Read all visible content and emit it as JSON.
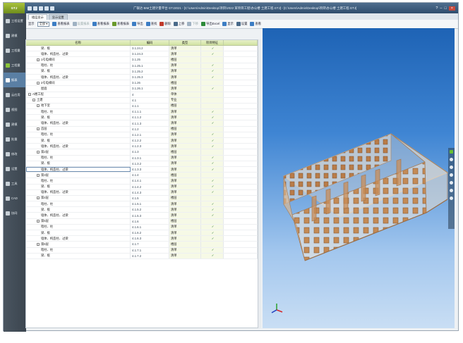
{
  "app": {
    "logo": "GTJ",
    "title": "广联达 BIM土建计量平台 GTJ2021 - [C:\\Users\\Admin\\Desktop\\项目\\2022 某项目工程\\办公楼 土建工程.GTJ] - [C:\\Users\\Admin\\Desktop\\项目\\办公楼 土建工程.GTJ]"
  },
  "sidebar": {
    "items": [
      {
        "label": "工程设置",
        "icon": "settings-icon"
      },
      {
        "label": "建模",
        "icon": "pencil-icon"
      },
      {
        "label": "工程量",
        "icon": "calculator-icon"
      },
      {
        "label": "工程量",
        "icon": "list-icon"
      },
      {
        "label": "报表",
        "icon": "report-icon"
      },
      {
        "label": "云应用",
        "icon": "cloud-icon"
      },
      {
        "label": "视图",
        "icon": "eye-icon"
      },
      {
        "label": "建模",
        "icon": "cube-icon"
      },
      {
        "label": "批量",
        "icon": "grid-icon"
      },
      {
        "label": "修改",
        "icon": "edit-icon"
      },
      {
        "label": "设置",
        "icon": "gear-icon"
      },
      {
        "label": "工具",
        "icon": "wrench-icon"
      },
      {
        "label": "CAD",
        "icon": "cad-icon"
      },
      {
        "label": "协同",
        "icon": "share-icon"
      }
    ],
    "active_index": 4
  },
  "tabs": [
    {
      "label": "楼层显示"
    },
    {
      "label": "显示设置"
    }
  ],
  "toolbar": {
    "filter_label": "显示",
    "filter_value": "全部",
    "buttons": [
      {
        "label": "查看报表",
        "icon": "table-icon",
        "dim": false
      },
      {
        "label": "设置报表",
        "icon": "table-icon",
        "dim": true
      },
      {
        "label": "查看报表",
        "icon": "report-icon",
        "dim": false
      },
      {
        "label": "查看报表",
        "icon": "arrow-icon",
        "dim": false
      },
      {
        "label": "导出",
        "icon": "export-icon",
        "dim": false
      },
      {
        "label": "查找",
        "icon": "find-icon",
        "dim": false
      },
      {
        "label": "删除",
        "icon": "delete-icon",
        "dim": false
      },
      {
        "label": "上移",
        "icon": "up-icon",
        "dim": false
      },
      {
        "label": "下移",
        "icon": "down-icon",
        "dim": true
      },
      {
        "label": "导出Excel",
        "icon": "excel-icon",
        "dim": false
      },
      {
        "label": "显示",
        "icon": "view-icon",
        "dim": false
      },
      {
        "label": "设置",
        "icon": "gear-icon",
        "dim": false
      },
      {
        "label": "查看",
        "icon": "settings-icon",
        "dim": false
      }
    ]
  },
  "table": {
    "columns": [
      "名称",
      "编码",
      "类型",
      "项目特征",
      ""
    ],
    "rows": [
      {
        "name": "梁、板",
        "code": "3.1.24.2",
        "type": "清单",
        "check": "✓",
        "indent": 3
      },
      {
        "name": "墙体、构造柱、过梁",
        "code": "3.1.24.3",
        "type": "清单",
        "check": "✓",
        "indent": 3
      },
      {
        "name": "1号电梯间",
        "code": "3.1.25",
        "type": "楼层",
        "check": "",
        "indent": 2,
        "group": true
      },
      {
        "name": "暗柱、柱",
        "code": "3.1.25.1",
        "type": "清单",
        "check": "✓",
        "indent": 3
      },
      {
        "name": "梁、板",
        "code": "3.1.25.2",
        "type": "清单",
        "check": "✓",
        "indent": 3
      },
      {
        "name": "墙体、构造柱、过梁",
        "code": "3.1.25.3",
        "type": "清单",
        "check": "✓",
        "indent": 3
      },
      {
        "name": "2号电梯间",
        "code": "3.1.26",
        "type": "楼层",
        "check": "",
        "indent": 2,
        "group": true
      },
      {
        "name": "屋面",
        "code": "3.1.26.1",
        "type": "清单",
        "check": "✓",
        "indent": 3
      },
      {
        "name": "A楼工程",
        "code": "4",
        "type": "单体",
        "check": "",
        "indent": 0,
        "group": true
      },
      {
        "name": "土建",
        "code": "4.1",
        "type": "专业",
        "check": "",
        "indent": 1,
        "group": true
      },
      {
        "name": "地下室",
        "code": "4.1.1",
        "type": "楼层",
        "check": "",
        "indent": 2,
        "group": true
      },
      {
        "name": "暗柱、柱",
        "code": "4.1.1.1",
        "type": "清单",
        "check": "✓",
        "indent": 3
      },
      {
        "name": "梁、板",
        "code": "4.1.1.2",
        "type": "清单",
        "check": "✓",
        "indent": 3
      },
      {
        "name": "墙体、构造柱、过梁",
        "code": "4.1.1.3",
        "type": "清单",
        "check": "✓",
        "indent": 3
      },
      {
        "name": "首层",
        "code": "4.1.2",
        "type": "楼层",
        "check": "",
        "indent": 2,
        "group": true
      },
      {
        "name": "暗柱、柱",
        "code": "4.1.2.1",
        "type": "清单",
        "check": "✓",
        "indent": 3
      },
      {
        "name": "梁、板",
        "code": "4.1.2.2",
        "type": "清单",
        "check": "✓",
        "indent": 3
      },
      {
        "name": "墙体、构造柱、过梁",
        "code": "4.1.2.3",
        "type": "清单",
        "check": "✓",
        "indent": 3
      },
      {
        "name": "第2层",
        "code": "4.1.3",
        "type": "楼层",
        "check": "",
        "indent": 2,
        "group": true
      },
      {
        "name": "暗柱、柱",
        "code": "4.1.3.1",
        "type": "清单",
        "check": "✓",
        "indent": 3
      },
      {
        "name": "梁、板",
        "code": "4.1.3.2",
        "type": "清单",
        "check": "✓",
        "indent": 3
      },
      {
        "name": "墙体、构造柱、过梁",
        "code": "4.1.3.3",
        "type": "清单",
        "check": "✓",
        "indent": 3,
        "selected": true
      },
      {
        "name": "第3层",
        "code": "4.1.4",
        "type": "楼层",
        "check": "",
        "indent": 2,
        "group": true
      },
      {
        "name": "暗柱、柱",
        "code": "4.1.4.1",
        "type": "清单",
        "check": "✓",
        "indent": 3
      },
      {
        "name": "梁、板",
        "code": "4.1.4.2",
        "type": "清单",
        "check": "✓",
        "indent": 3
      },
      {
        "name": "墙体、构造柱、过梁",
        "code": "4.1.4.3",
        "type": "清单",
        "check": "✓",
        "indent": 3
      },
      {
        "name": "第4层",
        "code": "4.1.5",
        "type": "楼层",
        "check": "",
        "indent": 2,
        "group": true
      },
      {
        "name": "暗柱、柱",
        "code": "4.1.5.1",
        "type": "清单",
        "check": "✓",
        "indent": 3
      },
      {
        "name": "梁、板",
        "code": "4.1.5.2",
        "type": "清单",
        "check": "✓",
        "indent": 3
      },
      {
        "name": "墙体、构造柱、过梁",
        "code": "4.1.5.3",
        "type": "清单",
        "check": "✓",
        "indent": 3
      },
      {
        "name": "第5层",
        "code": "4.1.6",
        "type": "楼层",
        "check": "",
        "indent": 2,
        "group": true
      },
      {
        "name": "暗柱、柱",
        "code": "4.1.6.1",
        "type": "清单",
        "check": "✓",
        "indent": 3
      },
      {
        "name": "梁、板",
        "code": "4.1.6.2",
        "type": "清单",
        "check": "✓",
        "indent": 3
      },
      {
        "name": "墙体、构造柱、过梁",
        "code": "4.1.6.3",
        "type": "清单",
        "check": "✓",
        "indent": 3
      },
      {
        "name": "第6层",
        "code": "4.1.7",
        "type": "楼层",
        "check": "",
        "indent": 2,
        "group": true
      },
      {
        "name": "暗柱、柱",
        "code": "4.1.7.1",
        "type": "清单",
        "check": "✓",
        "indent": 3
      },
      {
        "name": "梁、板",
        "code": "4.1.7.2",
        "type": "清单",
        "check": "✓",
        "indent": 3
      }
    ]
  },
  "viewport": {
    "tools": [
      "select-icon",
      "pan-icon",
      "rotate-icon",
      "zoom-in-icon",
      "zoom-out-icon",
      "fit-icon",
      "search-icon"
    ]
  }
}
